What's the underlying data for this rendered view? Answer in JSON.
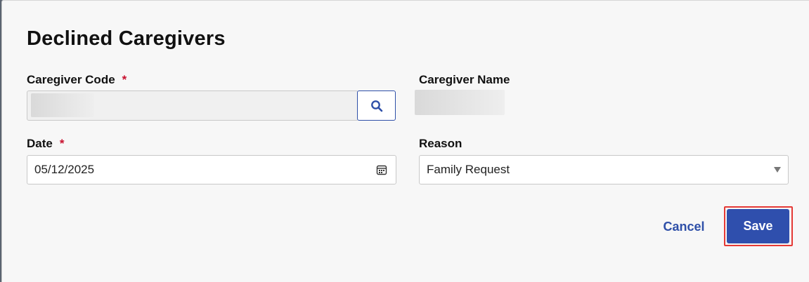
{
  "dialog": {
    "title": "Declined Caregivers",
    "caregiver_code": {
      "label": "Caregiver Code",
      "required_mark": "*",
      "value": ""
    },
    "caregiver_name": {
      "label": "Caregiver Name",
      "value": ""
    },
    "date": {
      "label": "Date",
      "required_mark": "*",
      "value": "05/12/2025"
    },
    "reason": {
      "label": "Reason",
      "value": "Family Request"
    },
    "actions": {
      "cancel_label": "Cancel",
      "save_label": "Save"
    }
  },
  "colors": {
    "accent": "#2f4fad",
    "required": "#c8102e",
    "highlight": "#e53935"
  },
  "icons": {
    "search": "search-icon",
    "calendar": "calendar-icon",
    "dropdown": "chevron-down-icon"
  }
}
